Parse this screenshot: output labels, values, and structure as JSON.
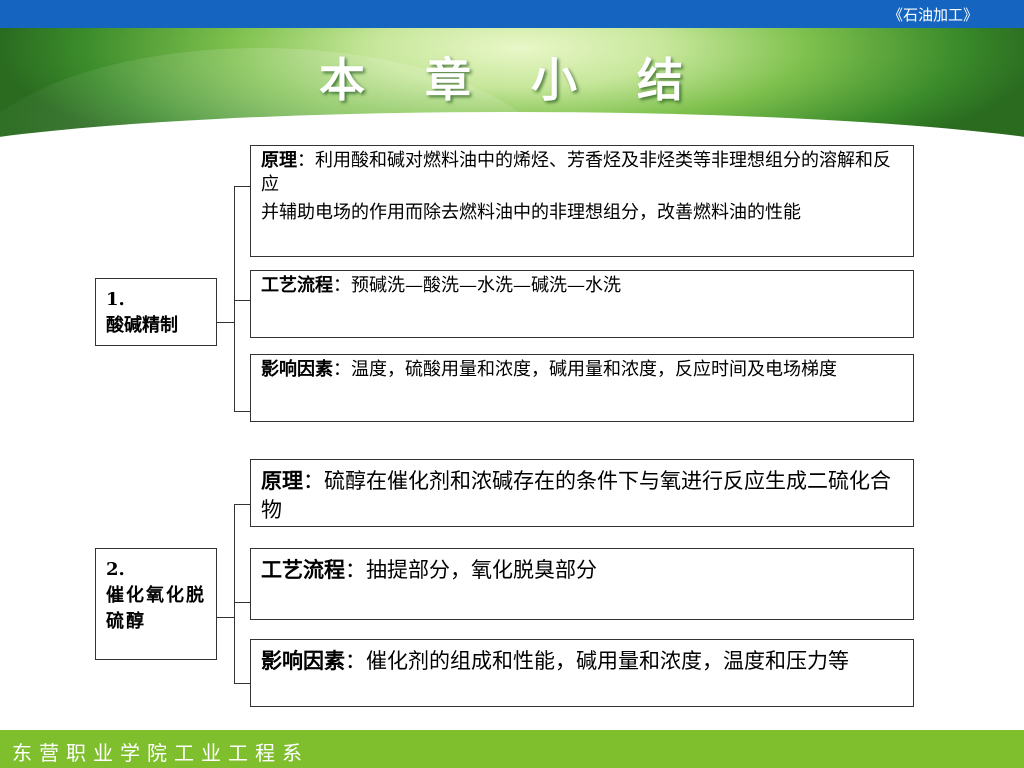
{
  "header": {
    "course_title": "《石油加工》",
    "slide_title": "本 章 小 结"
  },
  "sections": [
    {
      "label_number": "1.",
      "label_name": "酸碱精制",
      "items": [
        {
          "key": "原理",
          "sep": "：",
          "text": "利用酸和碱对燃料油中的烯烃、芳香烃及非烃类等非理想组分的溶解和反应",
          "text2": "并辅助电场的作用而除去燃料油中的非理想组分，改善燃料油的性能"
        },
        {
          "key": "工艺流程",
          "sep": "：",
          "text": "预碱洗—酸洗—水洗—碱洗—水洗"
        },
        {
          "key": "影响因素",
          "sep": "：",
          "text": "温度，硫酸用量和浓度，碱用量和浓度，反应时间及电场梯度"
        }
      ]
    },
    {
      "label_number": "2.",
      "label_name": "催化氧化脱硫醇",
      "items": [
        {
          "key": "原理",
          "sep": "：",
          "text": "硫醇在催化剂和浓碱存在的条件下与氧进行反应生成二硫化合物"
        },
        {
          "key": "工艺流程",
          "sep": "：",
          "text": "抽提部分，氧化脱臭部分"
        },
        {
          "key": "影响因素",
          "sep": "：",
          "text": "催化剂的组成和性能，碱用量和浓度，温度和压力等"
        }
      ]
    }
  ],
  "footer": {
    "department": "东营职业学院工业工程系"
  }
}
